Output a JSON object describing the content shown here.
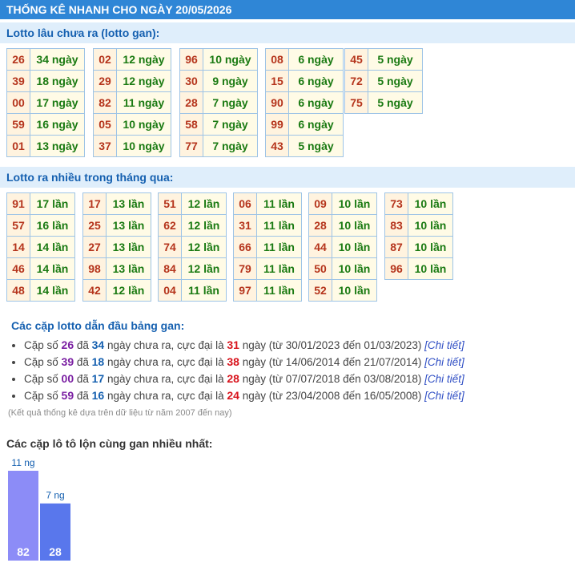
{
  "page": {
    "title": "THỐNG KÊ NHANH CHO NGÀY 20/05/2026"
  },
  "gan": {
    "header": "Lotto lâu chưa ra (lotto gan):",
    "columns": [
      [
        [
          "26",
          "34 ngày"
        ],
        [
          "39",
          "18 ngày"
        ],
        [
          "00",
          "17 ngày"
        ],
        [
          "59",
          "16 ngày"
        ],
        [
          "01",
          "13 ngày"
        ]
      ],
      [
        [
          "02",
          "12 ngày"
        ],
        [
          "29",
          "12 ngày"
        ],
        [
          "82",
          "11 ngày"
        ],
        [
          "05",
          "10 ngày"
        ],
        [
          "37",
          "10 ngày"
        ]
      ],
      [
        [
          "96",
          "10 ngày"
        ],
        [
          "30",
          "9 ngày"
        ],
        [
          "28",
          "7 ngày"
        ],
        [
          "58",
          "7 ngày"
        ],
        [
          "77",
          "7 ngày"
        ]
      ],
      [
        [
          "08",
          "6 ngày"
        ],
        [
          "15",
          "6 ngày"
        ],
        [
          "90",
          "6 ngày"
        ],
        [
          "99",
          "6 ngày"
        ],
        [
          "43",
          "5 ngày"
        ]
      ],
      [
        [
          "45",
          "5 ngày"
        ],
        [
          "72",
          "5 ngày"
        ],
        [
          "75",
          "5 ngày"
        ]
      ]
    ]
  },
  "frequent": {
    "header": "Lotto ra nhiều trong tháng qua:",
    "columns": [
      [
        [
          "91",
          "17 lần"
        ],
        [
          "57",
          "16 lần"
        ],
        [
          "14",
          "14 lần"
        ],
        [
          "46",
          "14 lần"
        ],
        [
          "48",
          "14 lần"
        ]
      ],
      [
        [
          "17",
          "13 lần"
        ],
        [
          "25",
          "13 lần"
        ],
        [
          "27",
          "13 lần"
        ],
        [
          "98",
          "13 lần"
        ],
        [
          "42",
          "12 lần"
        ]
      ],
      [
        [
          "51",
          "12 lần"
        ],
        [
          "62",
          "12 lần"
        ],
        [
          "74",
          "12 lần"
        ],
        [
          "84",
          "12 lần"
        ],
        [
          "04",
          "11 lần"
        ]
      ],
      [
        [
          "06",
          "11 lần"
        ],
        [
          "31",
          "11 lần"
        ],
        [
          "66",
          "11 lần"
        ],
        [
          "79",
          "11 lần"
        ],
        [
          "97",
          "11 lần"
        ]
      ],
      [
        [
          "09",
          "10 lần"
        ],
        [
          "28",
          "10 lần"
        ],
        [
          "44",
          "10 lần"
        ],
        [
          "50",
          "10 lần"
        ],
        [
          "52",
          "10 lần"
        ]
      ],
      [
        [
          "73",
          "10 lần"
        ],
        [
          "83",
          "10 lần"
        ],
        [
          "87",
          "10 lần"
        ],
        [
          "96",
          "10 lần"
        ]
      ]
    ]
  },
  "pairs": {
    "header": "Các cặp lotto dẫn đầu bảng gan:",
    "items": [
      {
        "prefix": "Cặp số",
        "pair": "26",
        "t1": "đã",
        "days": "34",
        "t2": "ngày chưa ra, cực đại là",
        "max": "31",
        "t3": "ngày (từ 30/01/2023 đến 01/03/2023)",
        "link": "[Chi tiết]"
      },
      {
        "prefix": "Cặp số",
        "pair": "39",
        "t1": "đã",
        "days": "18",
        "t2": "ngày chưa ra, cực đại là",
        "max": "38",
        "t3": "ngày (từ 14/06/2014 đến 21/07/2014)",
        "link": "[Chi tiết]"
      },
      {
        "prefix": "Cặp số",
        "pair": "00",
        "t1": "đã",
        "days": "17",
        "t2": "ngày chưa ra, cực đại là",
        "max": "28",
        "t3": "ngày (từ 07/07/2018 đến 03/08/2018)",
        "link": "[Chi tiết]"
      },
      {
        "prefix": "Cặp số",
        "pair": "59",
        "t1": "đã",
        "days": "16",
        "t2": "ngày chưa ra, cực đại là",
        "max": "24",
        "t3": "ngày (từ 23/04/2008 đến 16/05/2008)",
        "link": "[Chi tiết]"
      }
    ],
    "note": "(Kết quả thống kê dựa trên dữ liệu từ năm 2007 đến nay)"
  },
  "reverse_chart": {
    "title": "Các cặp lô tô lộn cùng gan nhiều nhất:"
  },
  "chart_data": {
    "type": "bar",
    "categories": [
      "82",
      "28"
    ],
    "values": [
      11,
      7
    ],
    "data_labels": [
      "11 ng",
      "7 ng"
    ],
    "colors": [
      "#8c8cf7",
      "#5977ec"
    ]
  }
}
